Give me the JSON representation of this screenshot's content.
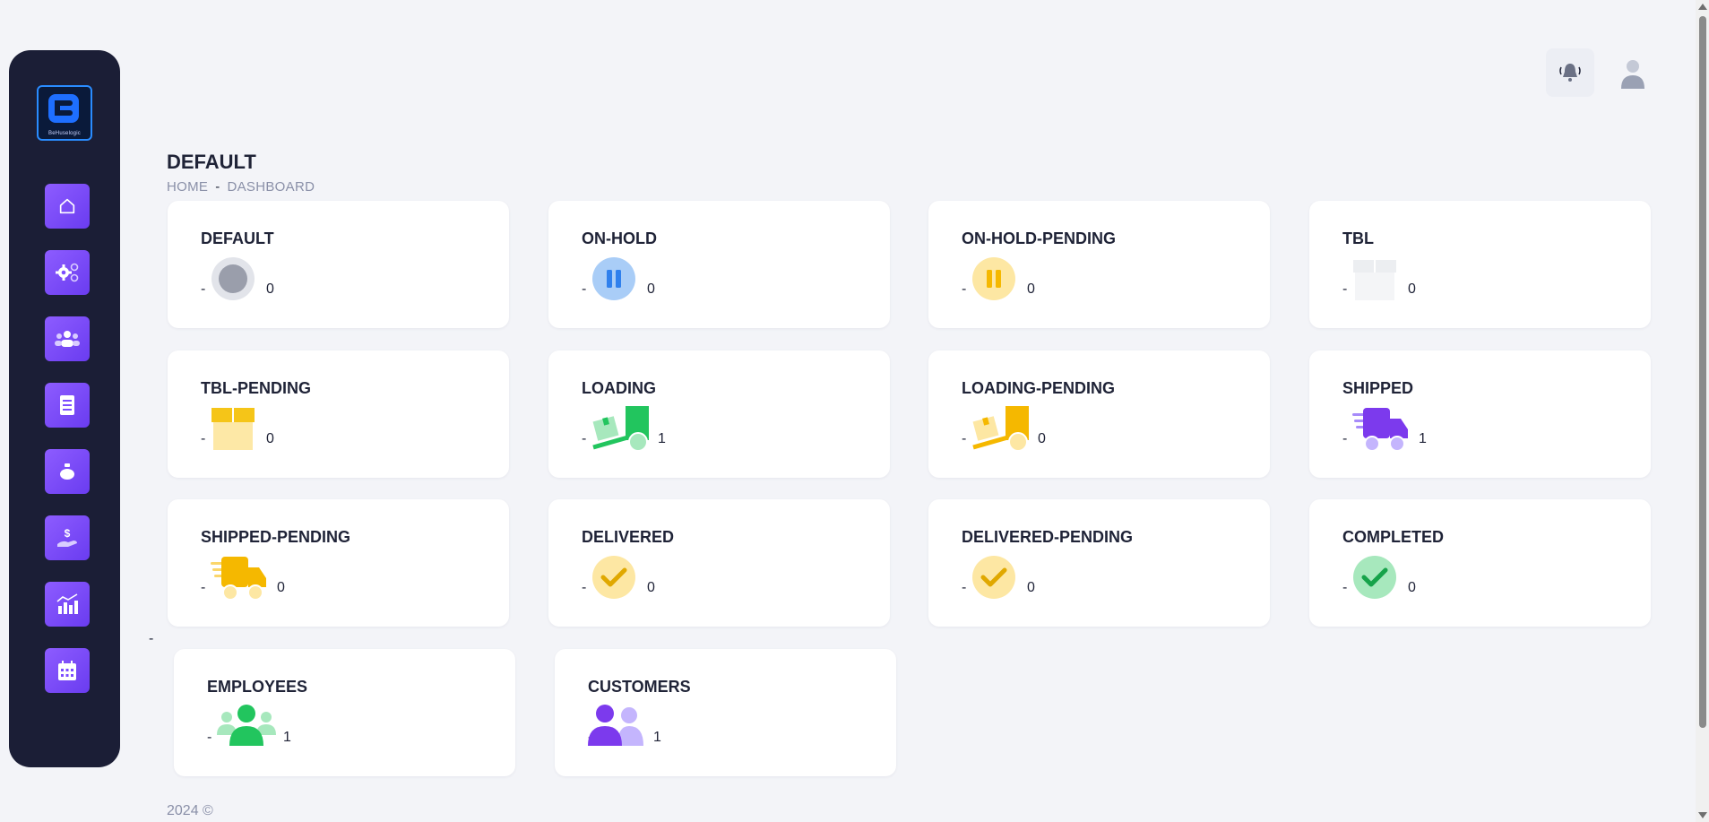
{
  "header": {
    "page_title": "DEFAULT",
    "breadcrumb": {
      "home": "HOME",
      "separator": "-",
      "current": "DASHBOARD"
    },
    "notification_icon": "bell-icon",
    "avatar_icon": "user-avatar-icon"
  },
  "sidebar": {
    "logo_text": "BeHuselogic",
    "items": [
      {
        "icon": "home-icon"
      },
      {
        "icon": "settings-gears-icon"
      },
      {
        "icon": "team-icon"
      },
      {
        "icon": "receipt-icon"
      },
      {
        "icon": "jar-icon"
      },
      {
        "icon": "money-hand-icon"
      },
      {
        "icon": "analytics-icon"
      },
      {
        "icon": "calendar-icon"
      }
    ]
  },
  "cards": [
    {
      "title": "DEFAULT",
      "dash": "-",
      "count": "0",
      "icon": "default-status-icon"
    },
    {
      "title": "ON-HOLD",
      "dash": "-",
      "count": "0",
      "icon": "pause-icon"
    },
    {
      "title": "ON-HOLD-PENDING",
      "dash": "-",
      "count": "0",
      "icon": "pause-pending-icon"
    },
    {
      "title": "TBL",
      "dash": "-",
      "count": "0",
      "icon": "box-icon"
    },
    {
      "title": "TBL-PENDING",
      "dash": "-",
      "count": "0",
      "icon": "box-pending-icon"
    },
    {
      "title": "LOADING",
      "dash": "-",
      "count": "1",
      "icon": "hand-truck-icon"
    },
    {
      "title": "LOADING-PENDING",
      "dash": "-",
      "count": "0",
      "icon": "hand-truck-pending-icon"
    },
    {
      "title": "SHIPPED",
      "dash": "-",
      "count": "1",
      "icon": "delivery-truck-icon"
    },
    {
      "title": "SHIPPED-PENDING",
      "dash": "-",
      "count": "0",
      "icon": "delivery-truck-pending-icon"
    },
    {
      "title": "DELIVERED",
      "dash": "-",
      "count": "0",
      "icon": "check-pending-icon"
    },
    {
      "title": "DELIVERED-PENDING",
      "dash": "-",
      "count": "0",
      "icon": "check-pending-icon"
    },
    {
      "title": "COMPLETED",
      "dash": "-",
      "count": "0",
      "icon": "check-complete-icon"
    },
    {
      "title": "EMPLOYEES",
      "dash": "-",
      "count": "1",
      "icon": "employees-icon"
    },
    {
      "title": "CUSTOMERS",
      "dash": "-",
      "count": "1",
      "icon": "customers-icon"
    }
  ],
  "stray_dash": "-",
  "footer": {
    "text": "2024 ©"
  },
  "colors": {
    "sidebar_bg": "#1b1e36",
    "nav_accent": "#7c4dff",
    "page_bg": "#f3f4f8",
    "green": "#22c55e",
    "yellow": "#f5c518",
    "blue": "#2f80ed",
    "purple": "#7c3aed"
  }
}
